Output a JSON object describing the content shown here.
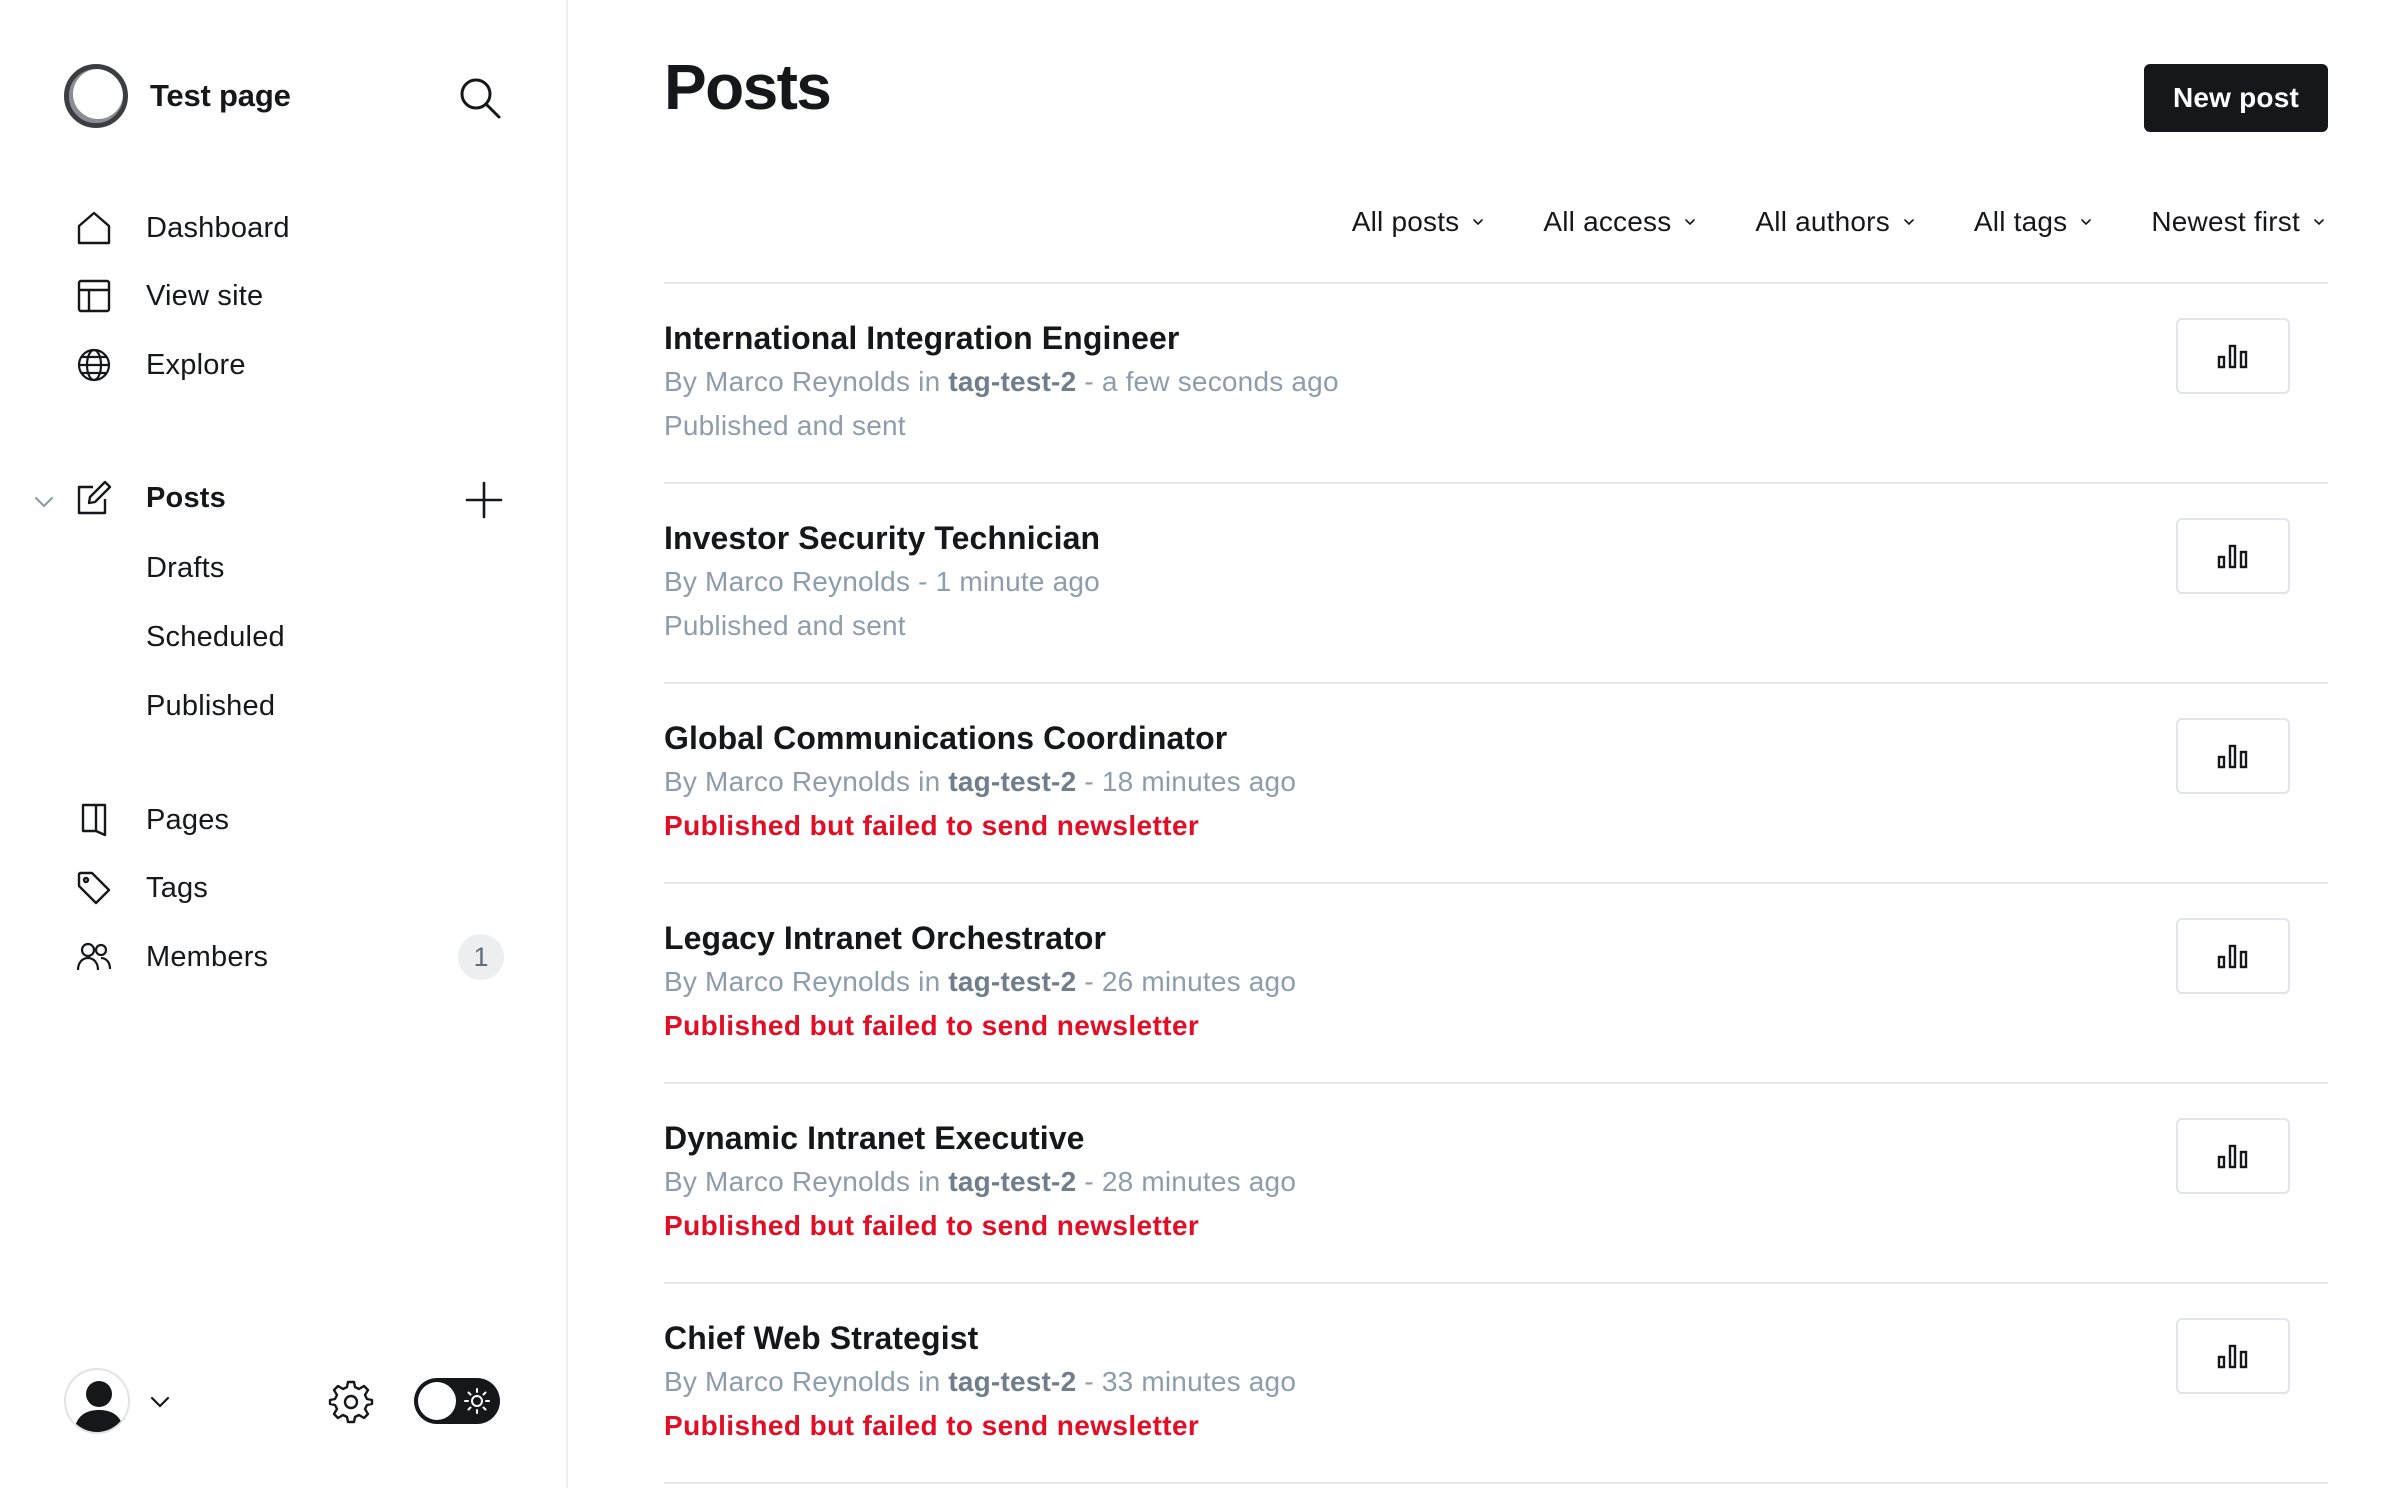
{
  "brand": {
    "name": "Test page"
  },
  "nav": {
    "items": [
      {
        "label": "Dashboard",
        "icon": "house-icon"
      },
      {
        "label": "View site",
        "icon": "layout-icon"
      },
      {
        "label": "Explore",
        "icon": "globe-icon"
      }
    ],
    "posts": {
      "label": "Posts",
      "icon": "edit-icon"
    },
    "post_subitems": [
      "Drafts",
      "Scheduled",
      "Published"
    ],
    "secondary": [
      {
        "label": "Pages",
        "icon": "page-icon"
      },
      {
        "label": "Tags",
        "icon": "tag-icon"
      },
      {
        "label": "Members",
        "icon": "members-icon",
        "count": "1"
      }
    ]
  },
  "header": {
    "title": "Posts",
    "new_post_label": "New post"
  },
  "filters": [
    "All posts",
    "All access",
    "All authors",
    "All tags",
    "Newest first"
  ],
  "posts": [
    {
      "title": "International Integration Engineer",
      "by": "By Marco Reynolds",
      "in": " in ",
      "tag": "tag-test-2",
      "time": " - a few seconds ago",
      "status": "Published and sent",
      "status_type": "ok"
    },
    {
      "title": "Investor Security Technician",
      "by": "By Marco Reynolds",
      "in": "",
      "tag": "",
      "time": " - 1 minute ago",
      "status": "Published and sent",
      "status_type": "ok"
    },
    {
      "title": "Global Communications Coordinator",
      "by": "By Marco Reynolds",
      "in": " in ",
      "tag": "tag-test-2",
      "time": " - 18 minutes ago",
      "status": "Published but failed to send newsletter",
      "status_type": "fail"
    },
    {
      "title": "Legacy Intranet Orchestrator",
      "by": "By Marco Reynolds",
      "in": " in ",
      "tag": "tag-test-2",
      "time": " - 26 minutes ago",
      "status": "Published but failed to send newsletter",
      "status_type": "fail"
    },
    {
      "title": "Dynamic Intranet Executive",
      "by": "By Marco Reynolds",
      "in": " in ",
      "tag": "tag-test-2",
      "time": " - 28 minutes ago",
      "status": "Published but failed to send newsletter",
      "status_type": "fail"
    },
    {
      "title": "Chief Web Strategist",
      "by": "By Marco Reynolds",
      "in": " in ",
      "tag": "tag-test-2",
      "time": " - 33 minutes ago",
      "status": "Published but failed to send newsletter",
      "status_type": "fail"
    }
  ],
  "colors": {
    "accent": "#15171a",
    "error": "#e10e26",
    "muted": "#8e9cac"
  }
}
